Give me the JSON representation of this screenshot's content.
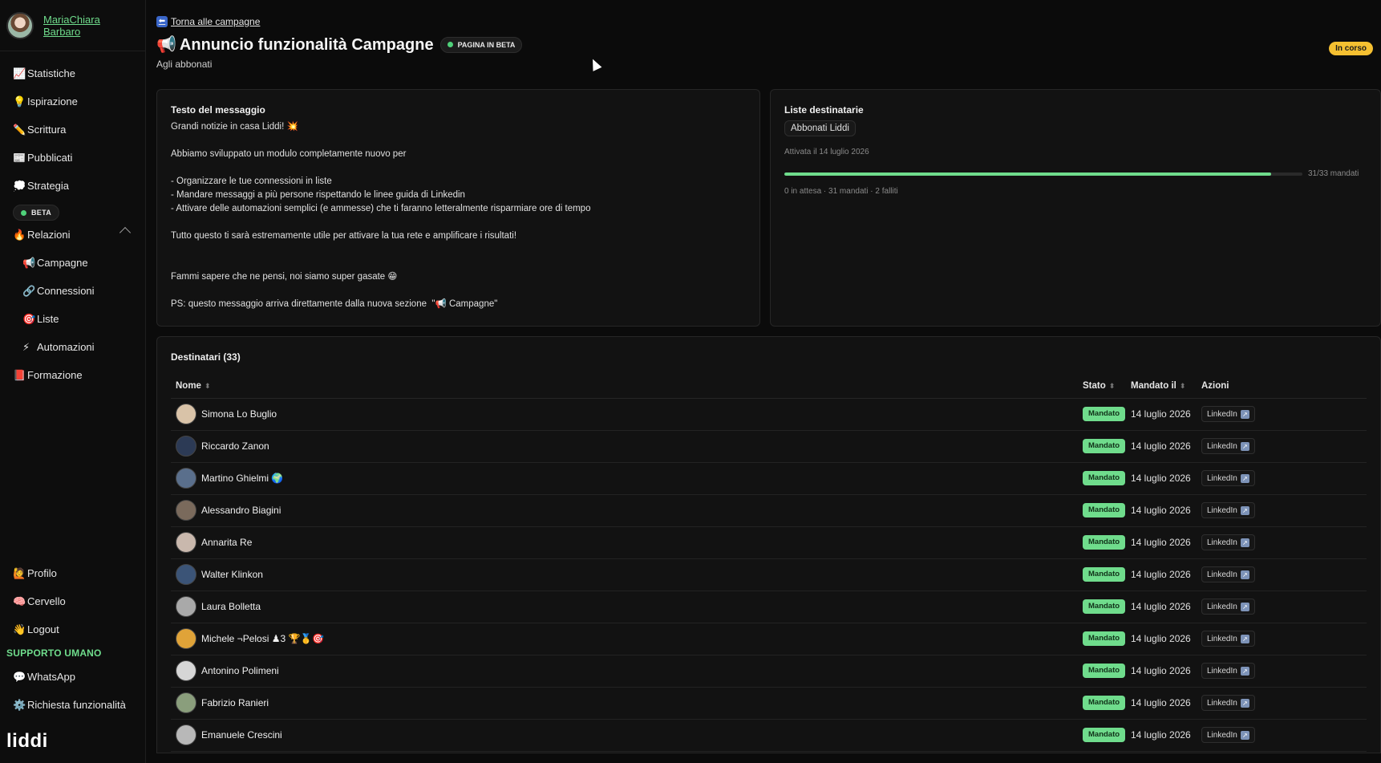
{
  "user": {
    "name": "MariaChiara Barbaro"
  },
  "sidebar": {
    "items": [
      {
        "icon": "📈",
        "label": "Statistiche"
      },
      {
        "icon": "💡",
        "label": "Ispirazione"
      },
      {
        "icon": "✏️",
        "label": "Scrittura"
      },
      {
        "icon": "📰",
        "label": "Pubblicati"
      },
      {
        "icon": "💭",
        "label": "Strategia"
      }
    ],
    "beta_label": "BETA",
    "relations": {
      "icon": "🔥",
      "label": "Relazioni"
    },
    "sub_items": [
      {
        "icon": "📢",
        "label": "Campagne"
      },
      {
        "icon": "🔗",
        "label": "Connessioni"
      },
      {
        "icon": "🎯",
        "label": "Liste"
      },
      {
        "icon": "⚡",
        "label": "Automazioni"
      }
    ],
    "training": {
      "icon": "📕",
      "label": "Formazione"
    },
    "bottom_items": [
      {
        "icon": "🙋",
        "label": "Profilo"
      },
      {
        "icon": "🧠",
        "label": "Cervello"
      },
      {
        "icon": "👋",
        "label": "Logout"
      }
    ],
    "support_title": "SUPPORTO UMANO",
    "support_items": [
      {
        "icon": "💬",
        "label": "WhatsApp"
      },
      {
        "icon": "⚙️",
        "label": "Richiesta funzionalità"
      }
    ],
    "logo": "liddi"
  },
  "header": {
    "back_icon": "⬅",
    "back_label": "Torna alle campagne",
    "title_icon": "📢",
    "title": "Annuncio funzionalità Campagne",
    "beta_tag": "PAGINA IN BETA",
    "subtitle": "Agli abbonati",
    "status": "In corso"
  },
  "message": {
    "title": "Testo del messaggio",
    "lines": [
      "Grandi notizie in casa Liddi! 💥",
      "",
      "Abbiamo sviluppato un modulo completamente nuovo per",
      "",
      "- Organizzare le tue connessioni in liste",
      "- Mandare messaggi a più persone rispettando le linee guida di Linkedin",
      "- Attivare delle automazioni semplici (e ammesse) che ti faranno letteralmente risparmiare ore di tempo",
      "",
      "Tutto questo ti sarà estremamente utile per attivare la tua rete e amplificare i risultati!",
      "",
      "",
      "Fammi sapere che ne pensi, noi siamo super gasate 😁",
      "",
      "PS: questo messaggio arriva direttamente dalla nuova sezione  \"📢 Campagne\""
    ]
  },
  "lists": {
    "title": "Liste destinatarie",
    "chip": "Abbonati Liddi",
    "activated": "Attivata il 14 luglio 2026",
    "progress": {
      "sent": 31,
      "total": 33,
      "label": "31/33 mandati"
    },
    "summary": "0 in attesa · 31 mandati · 2 falliti"
  },
  "recipients": {
    "title": "Destinatari (33)",
    "columns": {
      "name": "Nome",
      "status": "Stato",
      "sent_at": "Mandato il",
      "actions": "Azioni"
    },
    "sort_icon": "⬍",
    "rows": [
      {
        "name": "Simona Lo Buglio",
        "status": "Mandato",
        "date": "14 luglio 2026",
        "action": "LinkedIn",
        "color": "#d9c3a8"
      },
      {
        "name": "Riccardo Zanon",
        "status": "Mandato",
        "date": "14 luglio 2026",
        "action": "LinkedIn",
        "color": "#2c3a55"
      },
      {
        "name": "Martino Ghielmi 🌍",
        "status": "Mandato",
        "date": "14 luglio 2026",
        "action": "LinkedIn",
        "color": "#5a6f8c"
      },
      {
        "name": "Alessandro Biagini",
        "status": "Mandato",
        "date": "14 luglio 2026",
        "action": "LinkedIn",
        "color": "#7a6a5c"
      },
      {
        "name": "Annarita Re",
        "status": "Mandato",
        "date": "14 luglio 2026",
        "action": "LinkedIn",
        "color": "#c9b8ad"
      },
      {
        "name": "Walter Klinkon",
        "status": "Mandato",
        "date": "14 luglio 2026",
        "action": "LinkedIn",
        "color": "#3b5477"
      },
      {
        "name": "Laura Bolletta",
        "status": "Mandato",
        "date": "14 luglio 2026",
        "action": "LinkedIn",
        "color": "#a9a9a9"
      },
      {
        "name": "Michele ¬Pelosi ♟3 🏆🥇🎯",
        "status": "Mandato",
        "date": "14 luglio 2026",
        "action": "LinkedIn",
        "color": "#e0a338"
      },
      {
        "name": "Antonino Polimeni",
        "status": "Mandato",
        "date": "14 luglio 2026",
        "action": "LinkedIn",
        "color": "#d6d6d6"
      },
      {
        "name": "Fabrizio Ranieri",
        "status": "Mandato",
        "date": "14 luglio 2026",
        "action": "LinkedIn",
        "color": "#8a9e7c"
      },
      {
        "name": "Emanuele Crescini",
        "status": "Mandato",
        "date": "14 luglio 2026",
        "action": "LinkedIn",
        "color": "#b8b8b8"
      },
      {
        "name": "",
        "status": "",
        "date": "",
        "action": "",
        "color": "#cccccc"
      }
    ]
  },
  "colors": {
    "accent": "#6fdc8c",
    "status_in_progress": "#f5c031",
    "link_icon": "#3a66c9"
  }
}
